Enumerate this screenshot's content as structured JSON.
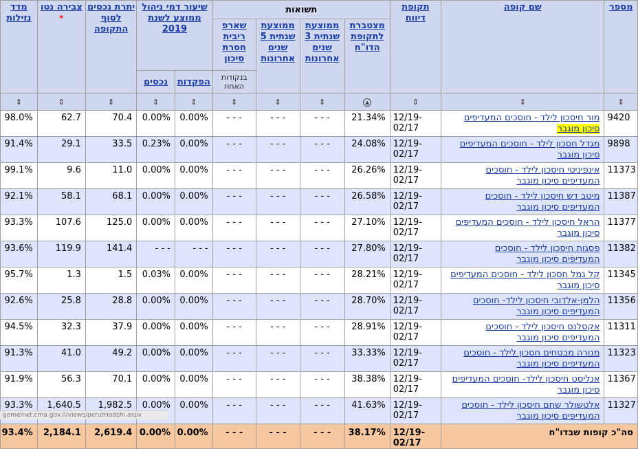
{
  "group_header": "תשואות",
  "columns": {
    "number": "מספר",
    "fund_name": "שם קופה",
    "period": "תקופת דיווח",
    "cumulative": "מצטברת לתקופת הדו\"ח",
    "avg3": "ממוצעת שנתית 3 שנים אחרונות",
    "avg5": "ממוצעת שנתית 5 שנים אחרונות",
    "sharpe": "שארפ ריבית חסרת סיכון",
    "mgmt_fee": "שיעור דמי ניהול ממוצע לשנת 2019",
    "deposits": "הפקדות",
    "assets": "נכסים",
    "balance": "יתרת נכסים לסוף התקופה",
    "net_accum": "צבירה נטו",
    "liquidity": "מדד נזילות"
  },
  "sub_labels": {
    "percent_hold": "בנקודות האחוז"
  },
  "net_accum_marker": "*",
  "sort_glyph": "⇕",
  "sort_active_glyph": "▲",
  "rows": [
    {
      "id": "9420",
      "name": "מור חיסכון לילד - חוסכים המעדיפים",
      "risk": "סיכון מוגבר",
      "period": "12/19-02/17",
      "cum": "21.34%",
      "a3": "- - -",
      "a5": "- - -",
      "sharpe": "- - -",
      "dep": "0.00%",
      "ast": "0.00%",
      "bal": "70.4",
      "net": "62.7",
      "liq": "98.0%",
      "hl": true
    },
    {
      "id": "9898",
      "name": "מגדל חסכון לילד - חוסכים המעדיפים",
      "risk": "סיכון מוגבר",
      "period": "12/19-02/17",
      "cum": "24.08%",
      "a3": "- - -",
      "a5": "- - -",
      "sharpe": "- - -",
      "dep": "0.00%",
      "ast": "0.23%",
      "bal": "33.5",
      "net": "29.1",
      "liq": "91.4%"
    },
    {
      "id": "11373",
      "name": "אינפיניטי חיסכון לילד - חוסכים",
      "risk": "המעדיפים סיכון מוגבר",
      "period": "12/19-02/17",
      "cum": "26.26%",
      "a3": "- - -",
      "a5": "- - -",
      "sharpe": "- - -",
      "dep": "0.00%",
      "ast": "0.00%",
      "bal": "11.0",
      "net": "9.6",
      "liq": "99.1%"
    },
    {
      "id": "11387",
      "name": "מיטב דש חיסכון לילד - חוסכים",
      "risk": "המעדיפים סיכון מוגבר",
      "period": "12/19-02/17",
      "cum": "26.58%",
      "a3": "- - -",
      "a5": "- - -",
      "sharpe": "- - -",
      "dep": "0.00%",
      "ast": "0.00%",
      "bal": "68.1",
      "net": "58.1",
      "liq": "92.1%"
    },
    {
      "id": "11377",
      "name": "הראל חיסכון לילד - חוסכים המעדיפים",
      "risk": "סיכון מוגבר",
      "period": "12/19-02/17",
      "cum": "27.10%",
      "a3": "- - -",
      "a5": "- - -",
      "sharpe": "- - -",
      "dep": "0.00%",
      "ast": "0.00%",
      "bal": "125.0",
      "net": "107.6",
      "liq": "93.3%"
    },
    {
      "id": "11382",
      "name": "פסגות חיסכון לילד - חוסכים",
      "risk": "המעדיפים סיכון מוגבר",
      "period": "12/19-02/17",
      "cum": "27.80%",
      "a3": "- - -",
      "a5": "- - -",
      "sharpe": "- - -",
      "dep": "- - -",
      "ast": "- - -",
      "bal": "141.4",
      "net": "119.9",
      "liq": "93.6%"
    },
    {
      "id": "11345",
      "name": "קל גמל חסכון לילד - חוסכים המעדיפים",
      "risk": "סיכון מוגבר",
      "period": "12/19-02/17",
      "cum": "28.21%",
      "a3": "- - -",
      "a5": "- - -",
      "sharpe": "- - -",
      "dep": "0.00%",
      "ast": "0.03%",
      "bal": "1.5",
      "net": "1.3",
      "liq": "95.7%"
    },
    {
      "id": "11356",
      "name": "הלמן-אלדובי חיסכון לילד- חוסכים",
      "risk": "המעדיפים סיכון מוגבר",
      "period": "12/19-02/17",
      "cum": "28.70%",
      "a3": "- - -",
      "a5": "- - -",
      "sharpe": "- - -",
      "dep": "0.00%",
      "ast": "0.00%",
      "bal": "28.8",
      "net": "25.8",
      "liq": "92.6%"
    },
    {
      "id": "11311",
      "name": "אקסלנס חיסכון לילד - חוסכים",
      "risk": "המעדיפים סיכון מוגבר",
      "period": "12/19-02/17",
      "cum": "28.91%",
      "a3": "- - -",
      "a5": "- - -",
      "sharpe": "- - -",
      "dep": "0.00%",
      "ast": "0.00%",
      "bal": "37.9",
      "net": "32.3",
      "liq": "94.5%"
    },
    {
      "id": "11323",
      "name": "מנורה מבטחים חסכון לילד - חוסכים",
      "risk": "המעדיפים סיכון מוגבר",
      "period": "12/19-02/17",
      "cum": "33.33%",
      "a3": "- - -",
      "a5": "- - -",
      "sharpe": "- - -",
      "dep": "0.00%",
      "ast": "0.00%",
      "bal": "49.2",
      "net": "41.0",
      "liq": "91.3%"
    },
    {
      "id": "11367",
      "name": "אנליסט חיסכון לילד- חוסכים המעדיפים",
      "risk": "סיכון מוגבר",
      "period": "12/19-02/17",
      "cum": "38.38%",
      "a3": "- - -",
      "a5": "- - -",
      "sharpe": "- - -",
      "dep": "0.00%",
      "ast": "0.00%",
      "bal": "70.1",
      "net": "56.3",
      "liq": "91.9%"
    },
    {
      "id": "11327",
      "name": "אלטשולר שחם חיסכון לילד - חוסכים",
      "risk": "המעדיפים סיכון מוגבר",
      "period": "12/19-02/17",
      "cum": "41.63%",
      "a3": "- - -",
      "a5": "- - -",
      "sharpe": "- - -",
      "dep": "0.00%",
      "ast": "0.00%",
      "bal": "1,982.5",
      "net": "1,640.5",
      "liq": "93.3%"
    }
  ],
  "total": {
    "label": "סה\"כ קופות שבדו\"ח",
    "period": "12/19-02/17",
    "cum": "38.17%",
    "a3": "- - -",
    "a5": "- - -",
    "sharpe": "- - -",
    "dep": "0.00%",
    "ast": "0.00%",
    "bal": "2,619.4",
    "net": "2,184.1",
    "liq": "93.4%"
  },
  "status_bar": "gemelnet.cma.gov.il/views/perutHodshi.aspx"
}
